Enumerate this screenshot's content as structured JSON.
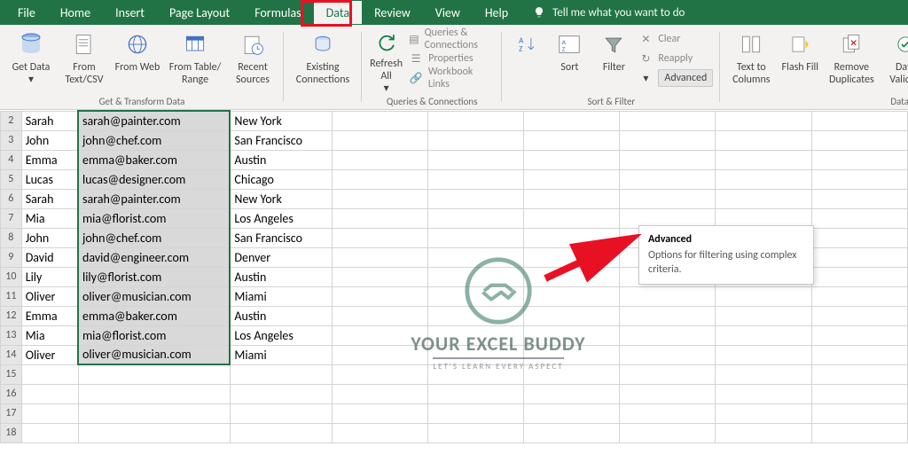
{
  "colors": {
    "brand": "#217346",
    "highlight": "#e81123"
  },
  "menu": {
    "tabs": [
      "File",
      "Home",
      "Insert",
      "Page Layout",
      "Formulas",
      "Data",
      "Review",
      "View",
      "Help"
    ],
    "active_index": 5,
    "tell_me": "Tell me what you want to do"
  },
  "ribbon": {
    "groups": {
      "get_transform": {
        "label": "Get & Transform Data",
        "buttons": {
          "get_data": "Get Data",
          "from_text": "From Text/CSV",
          "from_web": "From Web",
          "from_table": "From Table/ Range",
          "recent": "Recent Sources"
        }
      },
      "existing_connections": {
        "label": "Existing Connections"
      },
      "queries": {
        "label": "Queries & Connections",
        "refresh": "Refresh All",
        "items": [
          "Queries & Connections",
          "Properties",
          "Workbook Links"
        ]
      },
      "sort_filter": {
        "label": "Sort & Filter",
        "sort": "Sort",
        "filter": "Filter",
        "clear": "Clear",
        "reapply": "Reapply",
        "advanced": "Advanced"
      },
      "data_tools": {
        "label": "Data Tools",
        "text_to_columns": "Text to Columns",
        "flash_fill": "Flash Fill",
        "remove_duplicates": "Remove Duplicates",
        "validation": "Data Validati"
      }
    }
  },
  "tooltip": {
    "title": "Advanced",
    "body": "Options for filtering using complex criteria."
  },
  "watermark": {
    "title": "YOUR EXCEL BUDDY",
    "sub": "LET'S LEARN EVERY ASPECT"
  },
  "sheet": {
    "first_row": 2,
    "last_row": 18,
    "selected_col": "B",
    "rows": [
      {
        "n": 2,
        "a": "Sarah",
        "b": "sarah@painter.com",
        "c": "New York"
      },
      {
        "n": 3,
        "a": "John",
        "b": "john@chef.com",
        "c": "San Francisco"
      },
      {
        "n": 4,
        "a": "Emma",
        "b": "emma@baker.com",
        "c": "Austin"
      },
      {
        "n": 5,
        "a": "Lucas",
        "b": "lucas@designer.com",
        "c": "Chicago"
      },
      {
        "n": 6,
        "a": "Sarah",
        "b": "sarah@painter.com",
        "c": "New York"
      },
      {
        "n": 7,
        "a": "Mia",
        "b": "mia@florist.com",
        "c": "Los Angeles"
      },
      {
        "n": 8,
        "a": "John",
        "b": "john@chef.com",
        "c": "San Francisco"
      },
      {
        "n": 9,
        "a": "David",
        "b": "david@engineer.com",
        "c": "Denver"
      },
      {
        "n": 10,
        "a": "Lily",
        "b": "lily@florist.com",
        "c": "Austin"
      },
      {
        "n": 11,
        "a": "Oliver",
        "b": "oliver@musician.com",
        "c": "Miami"
      },
      {
        "n": 12,
        "a": "Emma",
        "b": "emma@baker.com",
        "c": "Austin"
      },
      {
        "n": 13,
        "a": "Mia",
        "b": "mia@florist.com",
        "c": "Los Angeles"
      },
      {
        "n": 14,
        "a": "Oliver",
        "b": "oliver@musician.com",
        "c": "Miami"
      },
      {
        "n": 15,
        "a": "",
        "b": "",
        "c": ""
      },
      {
        "n": 16,
        "a": "",
        "b": "",
        "c": ""
      },
      {
        "n": 17,
        "a": "",
        "b": "",
        "c": ""
      },
      {
        "n": 18,
        "a": "",
        "b": "",
        "c": ""
      }
    ]
  }
}
